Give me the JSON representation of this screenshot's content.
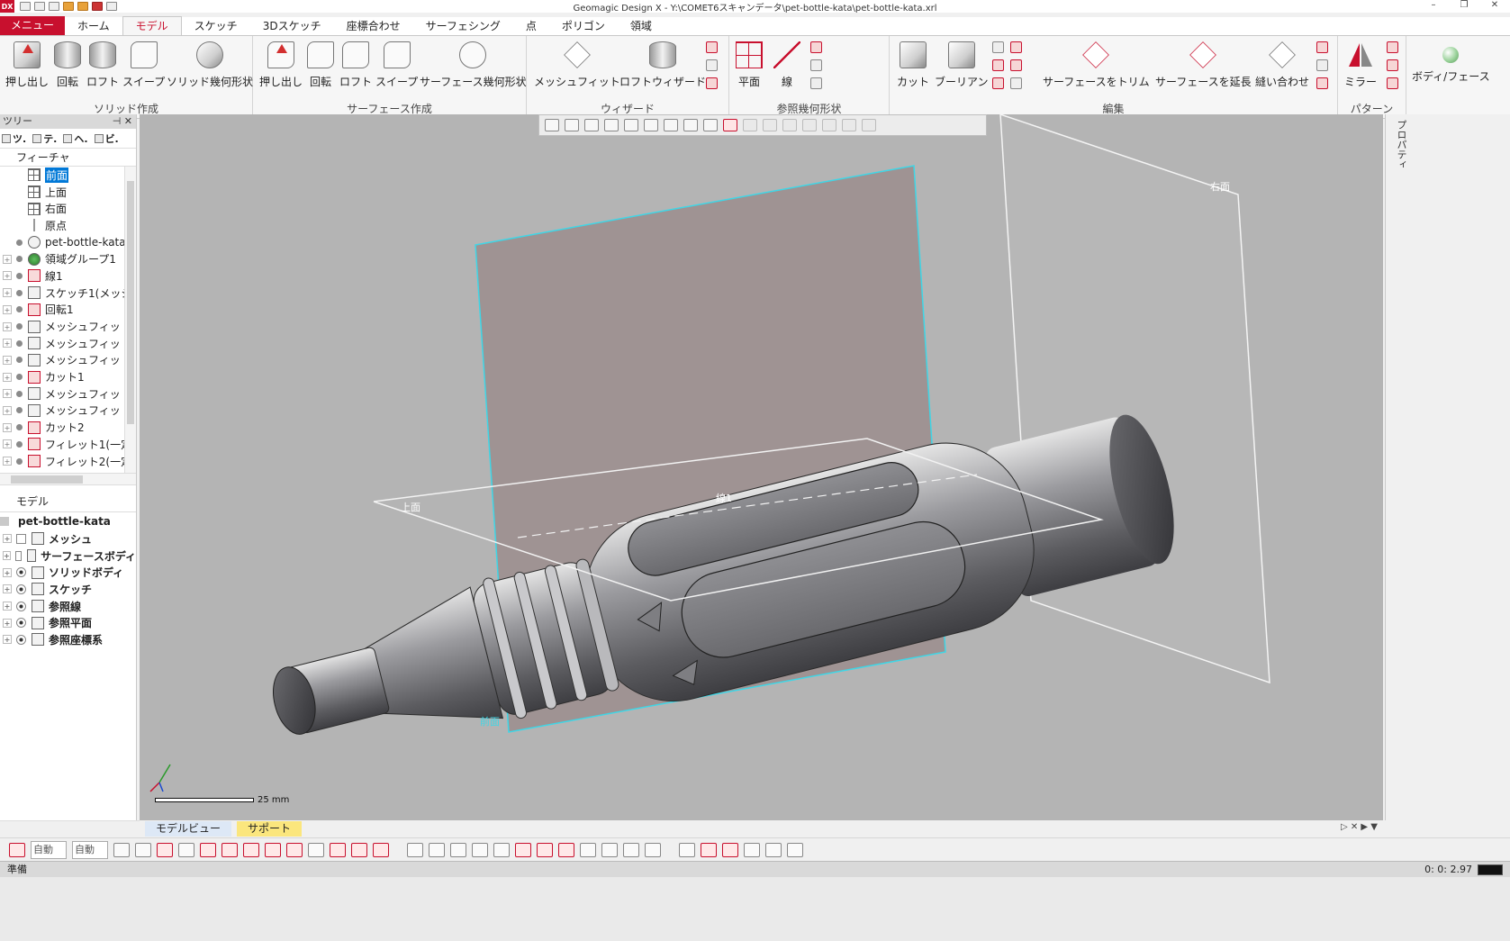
{
  "window": {
    "title": "Geomagic Design X - Y:\\COMET6スキャンデータ\\pet-bottle-kata\\pet-bottle-kata.xrl",
    "logo": "DX"
  },
  "ribbon_tabs": [
    "メニュー",
    "ホーム",
    "モデル",
    "スケッチ",
    "3Dスケッチ",
    "座標合わせ",
    "サーフェシング",
    "点",
    "ポリゴン",
    "領域"
  ],
  "ribbon": {
    "solid_group": "ソリッド作成",
    "surface_group": "サーフェース作成",
    "wizard_group": "ウィザード",
    "ref_group": "参照幾何形状",
    "edit_group": "編集",
    "pattern_group": "パターン",
    "solid_buttons": [
      "押し出し",
      "回転",
      "ロフト",
      "スイープ",
      "ソリッド幾何形状"
    ],
    "surface_buttons": [
      "押し出し",
      "回転",
      "ロフト",
      "スイープ",
      "サーフェース幾何形状"
    ],
    "wizard_buttons": [
      "メッシュフィット",
      "ロフトウィザード"
    ],
    "ref_buttons": [
      "平面",
      "線"
    ],
    "edit_buttons": [
      "カット",
      "ブーリアン",
      "サーフェースをトリム",
      "サーフェースを延長",
      "縫い合わせ"
    ],
    "pattern_buttons": [
      "ミラー"
    ],
    "body_face": "ボディ/フェース"
  },
  "tree_panel": {
    "title": "ツリー",
    "tabs": [
      "ツ.",
      "テ.",
      "ヘ.",
      "ビ."
    ],
    "feature_section": "フィーチャ",
    "features": [
      {
        "label": "前面",
        "icon": "plane-icon",
        "selected": true,
        "expandable": false,
        "dot": false
      },
      {
        "label": "上面",
        "icon": "plane-icon",
        "selected": false,
        "expandable": false,
        "dot": false
      },
      {
        "label": "右面",
        "icon": "plane-icon",
        "selected": false,
        "expandable": false,
        "dot": false
      },
      {
        "label": "原点",
        "icon": "origin-icon",
        "selected": false,
        "expandable": false,
        "dot": false
      },
      {
        "label": "pet-bottle-kata",
        "icon": "mesh-icon",
        "selected": false,
        "expandable": false,
        "dot": true
      },
      {
        "label": "領域グループ1",
        "icon": "region-group-icon",
        "selected": false,
        "expandable": true,
        "dot": true
      },
      {
        "label": "線1",
        "icon": "ref-line-icon",
        "selected": false,
        "expandable": true,
        "dot": true
      },
      {
        "label": "スケッチ1(メッシ",
        "icon": "sketch-icon",
        "selected": false,
        "expandable": true,
        "dot": true
      },
      {
        "label": "回転1",
        "icon": "revolve-icon",
        "selected": false,
        "expandable": true,
        "dot": true
      },
      {
        "label": "メッシュフィッ",
        "icon": "meshfit-icon",
        "selected": false,
        "expandable": true,
        "dot": true
      },
      {
        "label": "メッシュフィッ",
        "icon": "meshfit-icon",
        "selected": false,
        "expandable": true,
        "dot": true
      },
      {
        "label": "メッシュフィッ",
        "icon": "meshfit-icon",
        "selected": false,
        "expandable": true,
        "dot": true
      },
      {
        "label": "カット1",
        "icon": "cut-icon",
        "selected": false,
        "expandable": true,
        "dot": true
      },
      {
        "label": "メッシュフィッ",
        "icon": "meshfit-icon",
        "selected": false,
        "expandable": true,
        "dot": true
      },
      {
        "label": "メッシュフィッ",
        "icon": "meshfit-icon",
        "selected": false,
        "expandable": true,
        "dot": true
      },
      {
        "label": "カット2",
        "icon": "cut-icon",
        "selected": false,
        "expandable": true,
        "dot": true
      },
      {
        "label": "フィレット1(一定",
        "icon": "fillet-icon",
        "selected": false,
        "expandable": true,
        "dot": true
      },
      {
        "label": "フィレット2(一定",
        "icon": "fillet-icon",
        "selected": false,
        "expandable": true,
        "dot": true
      }
    ],
    "model_section": "モデル",
    "model_root": "pet-bottle-kata",
    "model_items": [
      {
        "label": "メッシュ",
        "eye": false
      },
      {
        "label": "サーフェースボディ",
        "eye": false
      },
      {
        "label": "ソリッドボディ",
        "eye": true
      },
      {
        "label": "スケッチ",
        "eye": true
      },
      {
        "label": "参照線",
        "eye": true
      },
      {
        "label": "参照平面",
        "eye": true
      },
      {
        "label": "参照座標系",
        "eye": true
      }
    ]
  },
  "viewport": {
    "labels": {
      "right_plane": "右面",
      "top_plane": "上面",
      "front_plane": "前面",
      "line": "線1"
    },
    "scale": "25 mm"
  },
  "right_dock": {
    "properties_label": "プロパティ"
  },
  "bottom_tabs": [
    "モデルビュー",
    "サポート"
  ],
  "bottom_toolbar": {
    "combo1": "自動",
    "combo2": "自動"
  },
  "status": {
    "text": "準備",
    "time": "0: 0: 2.97"
  },
  "colors": {
    "accent": "#c8102e",
    "viewport_bg": "#b4b4b4",
    "selected_plane_edge": "#3fd6e6",
    "plane_fill": "#9c8f8f"
  }
}
